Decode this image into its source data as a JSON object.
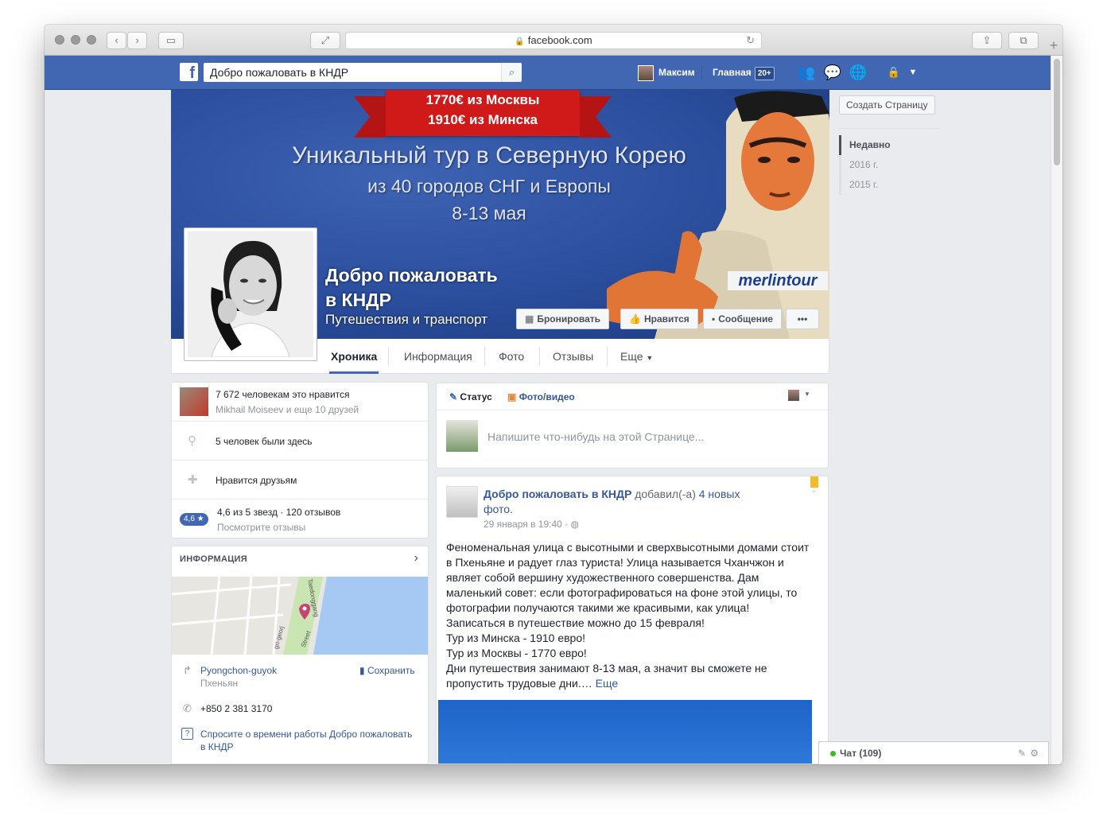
{
  "browser": {
    "url": "facebook.com"
  },
  "fbbar": {
    "search_value": "Добро пожаловать в КНДР",
    "user_name": "Максим",
    "home_label": "Главная",
    "home_badge": "20+"
  },
  "cover": {
    "price_moscow": "1770€ из Москвы",
    "price_minsk": "1910€ из Минска",
    "headline": "Уникальный тур в Северную Корею",
    "subline": "из 40 городов СНГ и Европы",
    "dates": "8-13 мая",
    "brand": "merlintour"
  },
  "page": {
    "name_line1": "Добро пожаловать",
    "name_line2": "в КНДР",
    "category": "Путешествия и транспорт",
    "buttons": {
      "book": "Бронировать",
      "like": "Нравится",
      "message": "Сообщение",
      "more": "•••"
    }
  },
  "tabs": {
    "timeline": "Хроника",
    "info": "Информация",
    "photos": "Фото",
    "reviews": "Отзывы",
    "more": "Еще"
  },
  "right_col": {
    "create_page": "Создать Страницу",
    "years": [
      "Недавно",
      "2016 г.",
      "2015 г."
    ]
  },
  "about": {
    "likes": "7 672 человекам это нравится",
    "likes_friends": "Mikhail Moiseev и еще 10 друзей",
    "checkins": "5 человек были здесь",
    "friends_like": "Нравится друзьям",
    "rating_pill": "4,6 ★",
    "rating_text": "4,6 из 5 звезд · 120 отзывов",
    "rating_link": "Посмотрите отзывы"
  },
  "info_card": {
    "heading": "ИНФОРМАЦИЯ",
    "address_link": "Pyongchon-guyok",
    "address_city": "Пхеньян",
    "save": "Сохранить",
    "phone": "+850 2 381 3170",
    "ask_hours_line1": "Спросите о времени работы Добро пожаловать",
    "ask_hours_line2": "в КНДР",
    "map_labels": {
      "street1": "Taedonggang",
      "street2": "Street",
      "street3": "gri-georj"
    }
  },
  "composer": {
    "status": "Статус",
    "photo_video": "Фото/видео",
    "placeholder": "Напишите что-нибудь на этой Странице..."
  },
  "post": {
    "author": "Добро пожаловать в КНДР",
    "added": " добавил(-а) ",
    "photos_line1": "4 новых",
    "photos_line2": "фото.",
    "time": "29 января в 19:40",
    "lines": [
      "Феноменальная улица с высотными и сверхвысотными домами стоит",
      "в Пхеньяне и радует глаз туриста! Улица называется Чханчжон и",
      "являет собой вершину художественного совершенства. Дам",
      "маленький совет: если фотографироваться на фоне этой улицы, то",
      "фотографии получаются такими же красивыми, как улица!",
      "Записаться в путешествие можно до 15 февраля!",
      "Тур из Минска - 1910 евро!",
      "Тур из Москвы - 1770 евро!",
      "Дни путешествия занимают 8-13 мая, а значит вы сможете не"
    ],
    "last_line": "пропустить трудовые дни.…",
    "more": "Еще"
  },
  "chat": {
    "label": "Чат (109)"
  }
}
